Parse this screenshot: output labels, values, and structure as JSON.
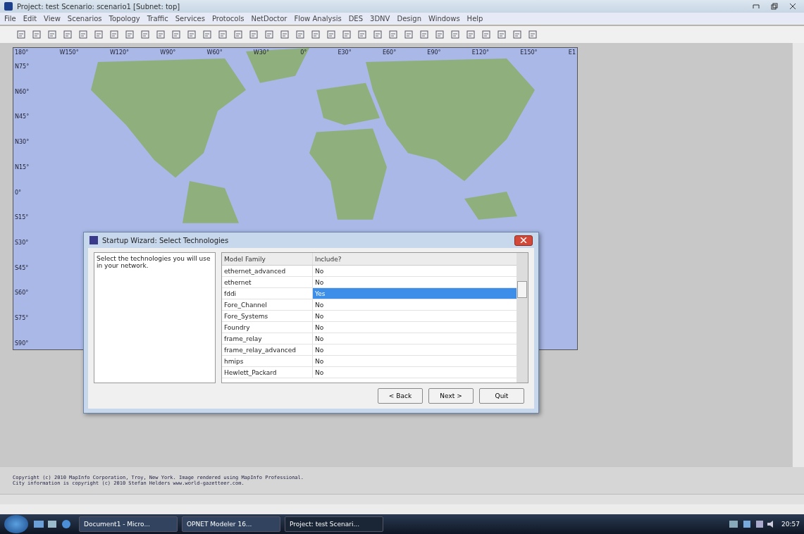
{
  "window": {
    "title": "Project: test Scenario: scenario1 [Subnet: top]"
  },
  "menu": [
    "File",
    "Edit",
    "View",
    "Scenarios",
    "Topology",
    "Traffic",
    "Services",
    "Protocols",
    "NetDoctor",
    "Flow Analysis",
    "DES",
    "3DNV",
    "Design",
    "Windows",
    "Help"
  ],
  "map": {
    "longitudes": [
      "180°",
      "W150°",
      "W120°",
      "W90°",
      "W60°",
      "W30°",
      "0°",
      "E30°",
      "E60°",
      "E90°",
      "E120°",
      "E150°",
      "E1"
    ],
    "latitudes": [
      "N75°",
      "N60°",
      "N45°",
      "N30°",
      "N15°",
      "0°",
      "S15°",
      "S30°",
      "S45°",
      "S60°",
      "S75°",
      "S90°"
    ]
  },
  "dialog": {
    "title": "Startup Wizard: Select Technologies",
    "instructions": "Select the technologies you will use in your network.",
    "columns": [
      "Model Family",
      "Include?"
    ],
    "rows": [
      {
        "family": "ethernet_advanced",
        "include": "No",
        "selected": false
      },
      {
        "family": "ethernet",
        "include": "No",
        "selected": false
      },
      {
        "family": "fddi",
        "include": "Yes",
        "selected": true
      },
      {
        "family": "Fore_Channel",
        "include": "No",
        "selected": false
      },
      {
        "family": "Fore_Systems",
        "include": "No",
        "selected": false
      },
      {
        "family": "Foundry",
        "include": "No",
        "selected": false
      },
      {
        "family": "frame_relay",
        "include": "No",
        "selected": false
      },
      {
        "family": "frame_relay_advanced",
        "include": "No",
        "selected": false
      },
      {
        "family": "hmips",
        "include": "No",
        "selected": false
      },
      {
        "family": "Hewlett_Packard",
        "include": "No",
        "selected": false
      }
    ],
    "buttons": [
      "< Back",
      "Next >",
      "Quit"
    ]
  },
  "messages": [
    "Copyright (c) 2010 MapInfo Corporation, Troy, New York. Image rendered using MapInfo Professional.",
    "City information is copyright (c) 2010 Stefan Helders www.world-gazetteer.com."
  ],
  "taskbar": {
    "tasks": [
      {
        "label": "Document1 - Micro...",
        "selected": false
      },
      {
        "label": "OPNET Modeler 16...",
        "selected": false
      },
      {
        "label": "Project: test Scenari...",
        "selected": true
      }
    ],
    "clock": "20:57"
  }
}
